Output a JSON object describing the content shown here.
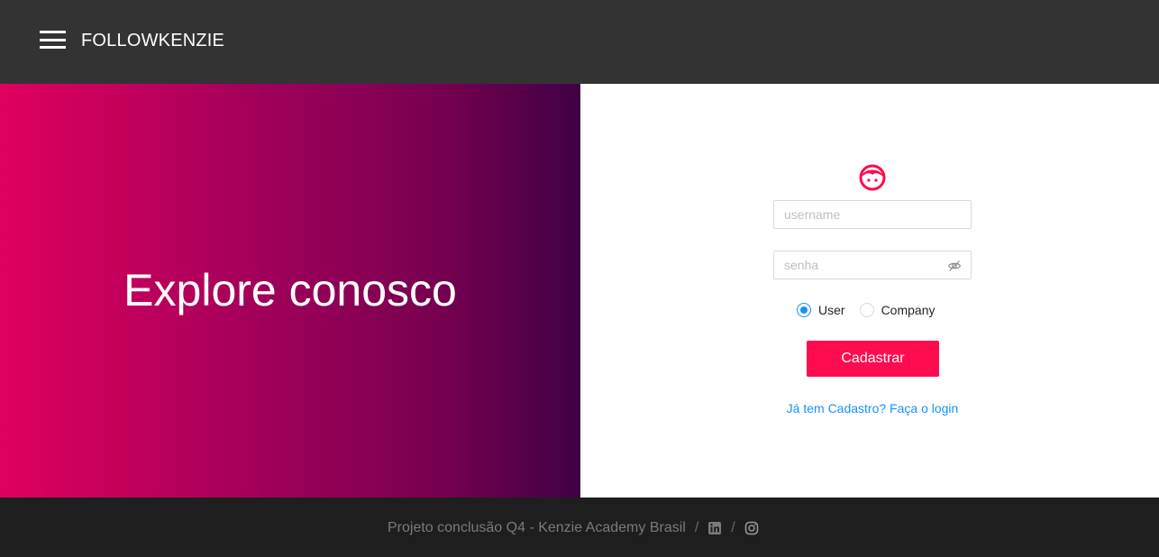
{
  "header": {
    "brand": "FOLLOWKENZIE",
    "menu_icon": "hamburger-menu-icon",
    "background": "#333333"
  },
  "hero": {
    "title": "Explore conosco",
    "gradient": [
      "#e0005e",
      "#400045"
    ]
  },
  "form": {
    "avatar_icon": "smiley-face-icon",
    "username_placeholder": "username",
    "password_placeholder": "senha",
    "password_toggle_icon": "eye-slash-icon",
    "radio_options": [
      {
        "label": "User",
        "selected": true
      },
      {
        "label": "Company",
        "selected": false
      }
    ],
    "submit_label": "Cadastrar",
    "login_link": "Já tem Cadastro? Faça o login",
    "accent": "#ff0b4f",
    "link_color": "#1890ff"
  },
  "footer": {
    "text": "Projeto conclusão Q4 - Kenzie Academy Brasil",
    "separator": "/",
    "icons": [
      "linkedin-icon",
      "instagram-icon"
    ]
  }
}
